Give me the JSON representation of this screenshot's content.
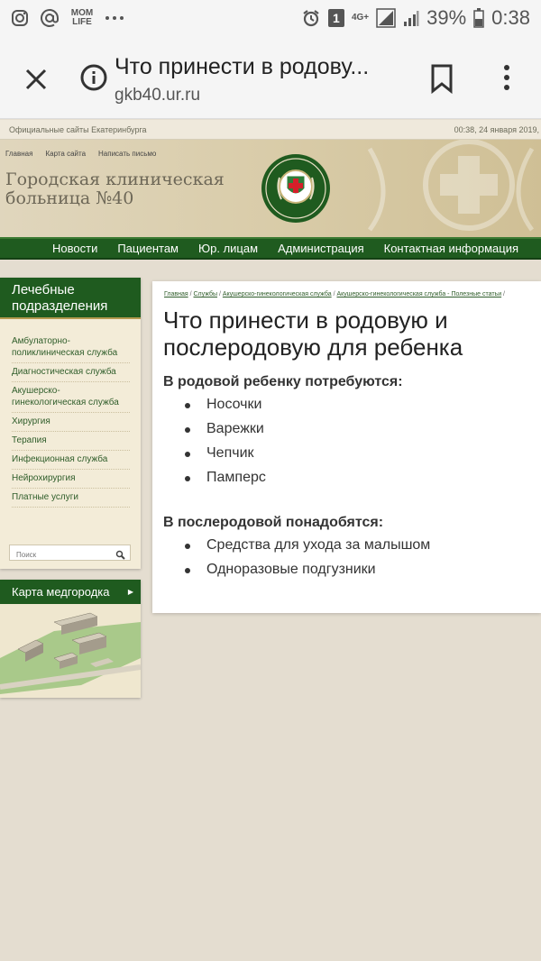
{
  "status_bar": {
    "app_badge": "MOM LIFE",
    "notification_count": "1",
    "network": "4G+",
    "battery": "39%",
    "time": "0:38"
  },
  "browser": {
    "page_title": "Что принести в родову...",
    "url": "gkb40.ur.ru"
  },
  "site": {
    "topline_left": "Официальные сайты Екатеринбурга",
    "topline_right": "00:38, 24 января 2019,",
    "header_links": [
      "Главная",
      "Карта сайта",
      "Написать письмо"
    ],
    "title_line1": "Городская клиническая",
    "title_line2": "больница №40",
    "emblem_text": "№40",
    "nav": [
      "Новости",
      "Пациентам",
      "Юр. лицам",
      "Администрация",
      "Контактная информация"
    ]
  },
  "sidebar": {
    "heading": "Лечебные подразделения",
    "items": [
      "Амбулаторно-поликлиническая служба",
      "Диагностическая служба",
      "Акушерско-гинекологическая служба",
      "Хирургия",
      "Терапия",
      "Инфекционная служба",
      "Нейрохирургия",
      "Платные услуги"
    ],
    "search_placeholder": "Поиск",
    "map_heading": "Карта медгородка"
  },
  "content": {
    "breadcrumbs": [
      "Главная",
      "Службы",
      "Акушерско-гинекологическая служба",
      "Акушерско-гинекологическая служба - Полезные статьи"
    ],
    "title": "Что принести в родовую и послеродовую для ребенка",
    "section1_title": "В родовой ребенку потребуются:",
    "section1_items": [
      "Носочки",
      "Варежки",
      "Чепчик",
      "Памперс"
    ],
    "section2_title": "В послеродовой понадобятся:",
    "section2_items": [
      "Средства для ухода за малышом",
      "Одноразовые подгузники"
    ]
  }
}
